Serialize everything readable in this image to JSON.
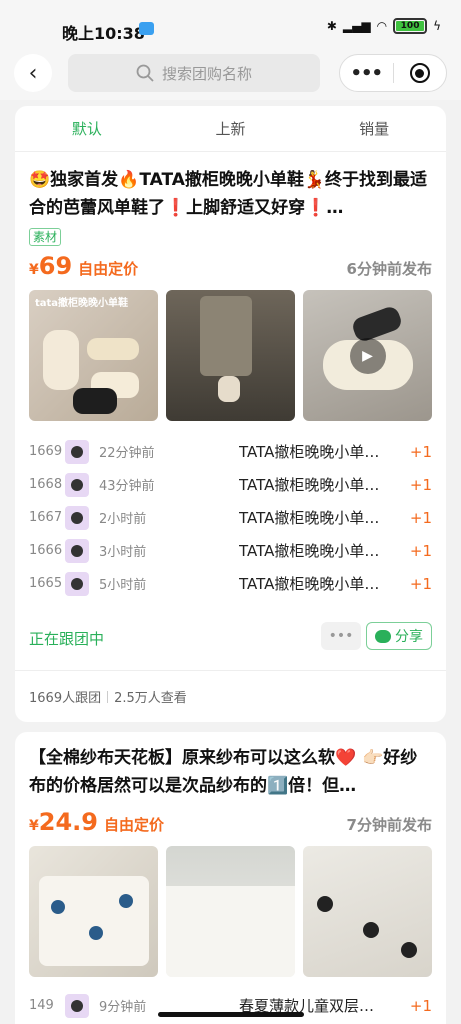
{
  "status_bar": {
    "time": "晚上10:38",
    "battery": "100"
  },
  "nav": {
    "search_placeholder": "搜索团购名称",
    "capsule_more": "•••"
  },
  "tabs": [
    "默认",
    "上新",
    "销量"
  ],
  "posts": [
    {
      "title": "🤩独家首发🔥TATA撤柜晚晚小单鞋💃终于找到最适合的芭蕾风单鞋了❗上脚舒适又好穿❗…",
      "tag": "素材",
      "price_symbol": "¥",
      "price": "69",
      "price_note": "自由定价",
      "time": "6分钟前发布",
      "image_caption": "tata撤柜晚晚小单鞋",
      "orders": [
        {
          "no": "1669",
          "time": "22分钟前",
          "item": "TATA撤柜晚晚小单…",
          "qty": "+1"
        },
        {
          "no": "1668",
          "time": "43分钟前",
          "item": "TATA撤柜晚晚小单…",
          "qty": "+1"
        },
        {
          "no": "1667",
          "time": "2小时前",
          "item": "TATA撤柜晚晚小单…",
          "qty": "+1"
        },
        {
          "no": "1666",
          "time": "3小时前",
          "item": "TATA撤柜晚晚小单…",
          "qty": "+1"
        },
        {
          "no": "1665",
          "time": "5小时前",
          "item": "TATA撤柜晚晚小单…",
          "qty": "+1"
        }
      ],
      "following": "正在跟团中",
      "more": "•••",
      "share": "分享",
      "participants": "1669人跟团",
      "views": "2.5万人查看"
    },
    {
      "title": "【全棉纱布天花板】原来纱布可以这么软❤️ 👉🏻好纱布的价格居然可以是次品纱布的1️⃣倍！但…",
      "price_symbol": "¥",
      "price": "24.9",
      "price_note": "自由定价",
      "time": "7分钟前发布",
      "partial_row": {
        "no": "149",
        "time": "9分钟前",
        "item": "春夏薄款儿童双层…",
        "qty": "+1"
      }
    }
  ],
  "colors": {
    "accent_green": "#2ab05a",
    "price_orange": "#f46a1e"
  }
}
